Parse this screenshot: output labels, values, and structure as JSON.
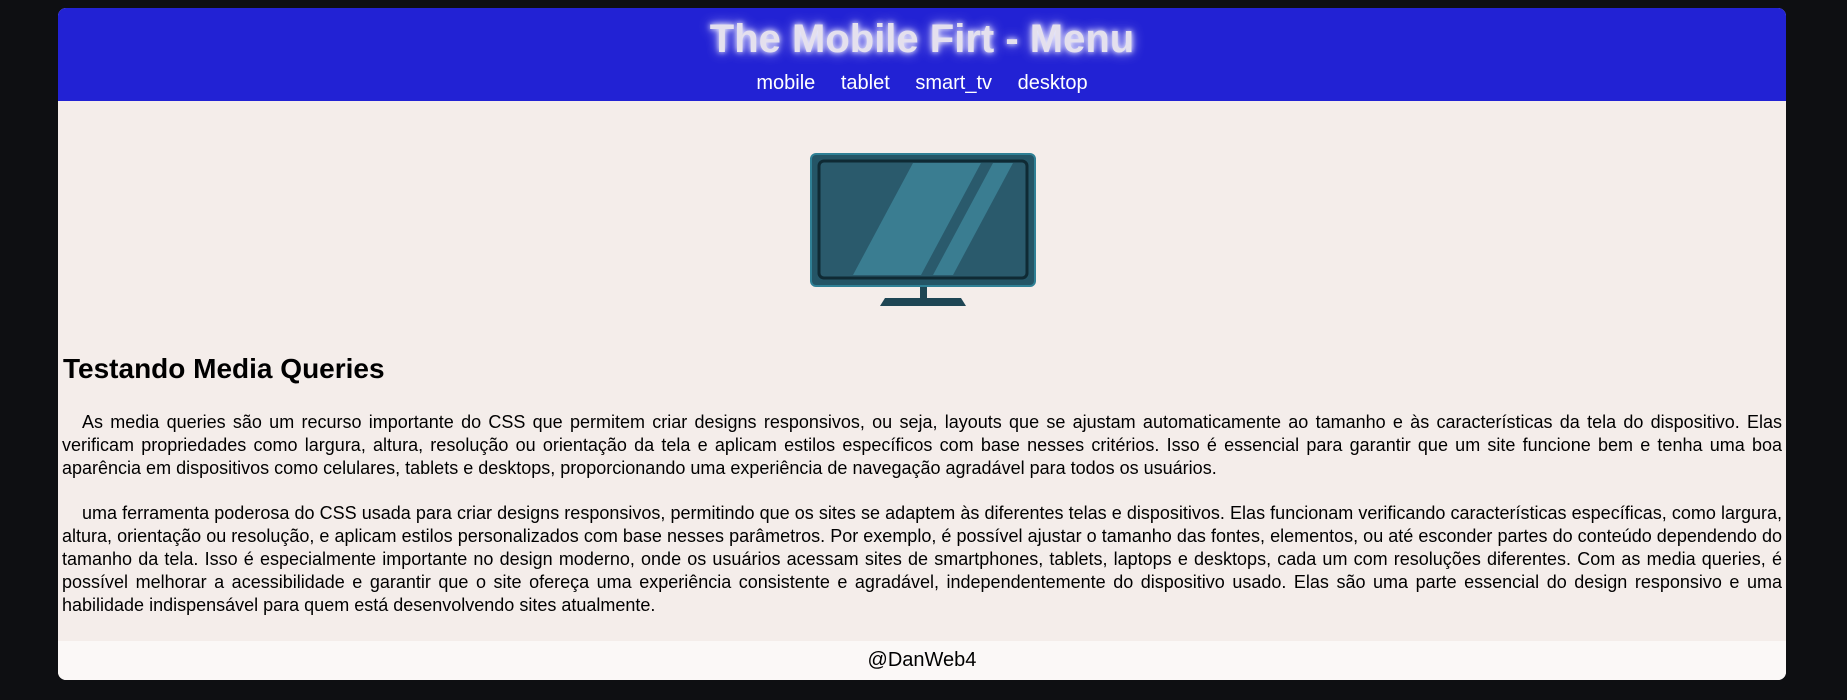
{
  "header": {
    "title": "The Mobile Firt - Menu",
    "nav": [
      "mobile",
      "tablet",
      "smart_tv",
      "desktop"
    ]
  },
  "hero": {
    "icon": "tv-icon"
  },
  "content": {
    "heading": "Testando Media Queries",
    "paragraphs": [
      "As media queries são um recurso importante do CSS que permitem criar designs responsivos, ou seja, layouts que se ajustam automaticamente ao tamanho e às características da tela do dispositivo. Elas verificam propriedades como largura, altura, resolução ou orientação da tela e aplicam estilos específicos com base nesses critérios. Isso é essencial para garantir que um site funcione bem e tenha uma boa aparência em dispositivos como celulares, tablets e desktops, proporcionando uma experiência de navegação agradável para todos os usuários.",
      "uma ferramenta poderosa do CSS usada para criar designs responsivos, permitindo que os sites se adaptem às diferentes telas e dispositivos. Elas funcionam verificando características específicas, como largura, altura, orientação ou resolução, e aplicam estilos personalizados com base nesses parâmetros. Por exemplo, é possível ajustar o tamanho das fontes, elementos, ou até esconder partes do conteúdo dependendo do tamanho da tela. Isso é especialmente importante no design moderno, onde os usuários acessam sites de smartphones, tablets, laptops e desktops, cada um com resoluções diferentes. Com as media queries, é possível melhorar a acessibilidade e garantir que o site ofereça uma experiência consistente e agradável, independentemente do dispositivo usado. Elas são uma parte essencial do design responsivo e uma habilidade indispensável para quem está desenvolvendo sites atualmente."
    ]
  },
  "footer": {
    "text": "@DanWeb4"
  },
  "colors": {
    "header_bg": "#2222d4",
    "content_bg": "#f4edea",
    "page_bg": "#0e0f12",
    "footer_bg": "#fbf8f7"
  }
}
